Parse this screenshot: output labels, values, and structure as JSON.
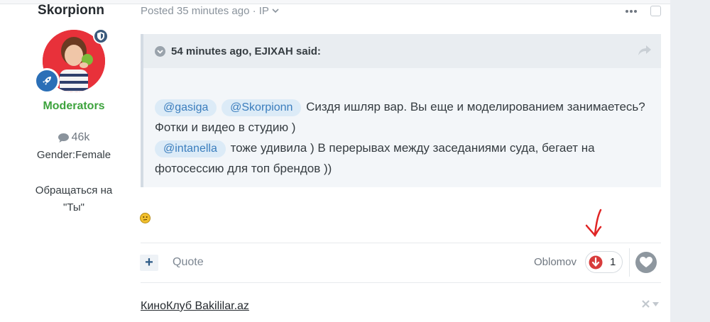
{
  "author": {
    "username": "Skorpionn",
    "group": "Moderators",
    "post_count": "46k",
    "gender": "Gender:Female",
    "note_line1": "Обращаться на",
    "note_line2": "\"Ты\""
  },
  "post": {
    "meta": "Posted 35 minutes ago · IP",
    "quote": {
      "header": "54 minutes ago, EJIXAH said:",
      "mention1": "@gasiga",
      "mention2": "@Skorpionn",
      "text1": "Сиздя ишляр вар. Вы еще и моделированием занимаетесь? Фотки и видео в студию )",
      "mention3": "@intanella",
      "text2": "тоже удивила ) В перерывах между заседаниями суда, бегает на фотосессию для топ брендов ))"
    },
    "footer": {
      "quote_label": "Quote",
      "reactor": "Oblomov",
      "reaction_count": "1"
    },
    "signature": "КиноКлуб Bakililar.az"
  },
  "colors": {
    "group": "#3da33d",
    "mention_bg": "#dcebf7",
    "mention_text": "#3a7dbd",
    "reaction_icon": "#d83c3c",
    "annotation_arrow": "#e02424"
  }
}
